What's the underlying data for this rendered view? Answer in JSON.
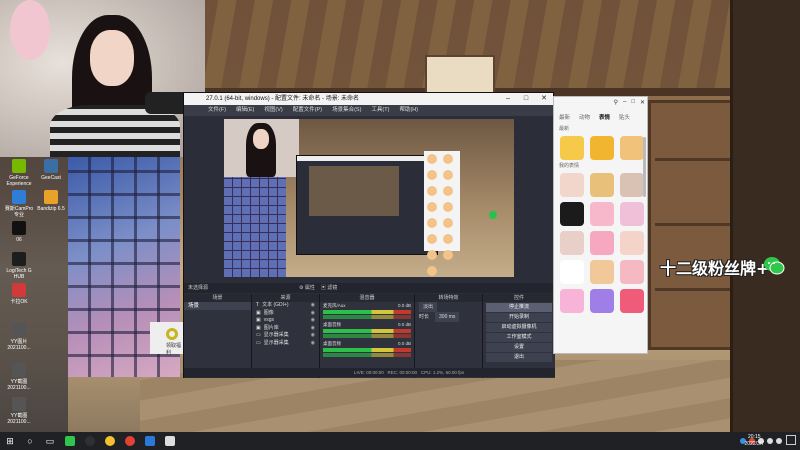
{
  "desktop": {
    "icons": [
      {
        "label": "GeForce Experience",
        "color": "#76b900"
      },
      {
        "label": "GeeCast",
        "color": "#3a6ea5"
      },
      {
        "label": "赛斯CamPro 专业",
        "color": "#2f7dd6"
      },
      {
        "label": "Bandizip 6.5",
        "color": "#e8a22a"
      },
      {
        "label": "06",
        "color": "#111111"
      },
      {
        "label": "LogiTech G HUB",
        "color": "#1d1d1d"
      },
      {
        "label": "卡拉OK",
        "color": "#d23a3a"
      },
      {
        "label": "YY图片 2021100...",
        "color": "#555555"
      },
      {
        "label": "YY截图 2021100...",
        "color": "#555555"
      },
      {
        "label": "YY截图 2021100...",
        "color": "#555555"
      }
    ]
  },
  "obs": {
    "title": "27.0.1 (64-bit, windows) - 配置文件: 未命名 - 场景: 未命名",
    "menu": [
      "文件(F)",
      "编辑(E)",
      "视图(V)",
      "配置文件(P)",
      "场景集合(S)",
      "工具(T)",
      "帮助(H)"
    ],
    "no_source_label": "未选择源",
    "properties_label": "属性",
    "filters_label": "滤镜",
    "docks": {
      "scenes": {
        "header": "场景",
        "items": [
          "场景"
        ]
      },
      "sources": {
        "header": "来源",
        "items": [
          "文本 (GDI+)",
          "图像",
          "vsgs",
          "图片库",
          "显示器采集",
          "显示器采集"
        ]
      },
      "mixer": {
        "header": "混音器",
        "channels": [
          {
            "name": "麦克风/Aux",
            "level": "0.0 dB"
          },
          {
            "name": "桌面音频",
            "level": "0.0 dB"
          },
          {
            "name": "桌面音频",
            "level": "0.0 dB"
          }
        ]
      },
      "transitions": {
        "header": "转场特效",
        "type": "淡出",
        "duration_label": "时长",
        "duration": "300 ms"
      },
      "controls": {
        "header": "控件",
        "buttons": [
          "停止推流",
          "开始录制",
          "启动虚拟摄像机",
          "工作室模式",
          "设置",
          "退出"
        ]
      }
    },
    "status": {
      "live": "LIVE: 00:00:00",
      "rec": "REC: 00:00:00",
      "cpu": "CPU: 1.2%, 60.00 fps"
    }
  },
  "emoji_panel": {
    "tabs": [
      "最新",
      "动物",
      "表情",
      "贴头"
    ],
    "active_tab": "表情",
    "section_top": "最新",
    "section_mid": "我的表情",
    "cells_row1": [
      "#f6c948",
      "#f1b52f",
      "#f0c27a"
    ],
    "cells_grid": [
      "#f2d6cc",
      "#e8c07a",
      "#d9c2b3",
      "#1b1b1b",
      "#f7b8cc",
      "#f0c0d8",
      "#e8d0c8",
      "#f6a8c0",
      "#f4d3c8",
      "#ffffff",
      "#f0c89a",
      "#f5b9c4",
      "#f7b3d8",
      "#9f7ee8",
      "#ef5b78"
    ]
  },
  "overlay": {
    "fan_text": "十二级粉丝牌+",
    "small_ad_label": "领取福利"
  },
  "taskbar": {
    "apps": [
      {
        "name": "windows-start",
        "color": "#ffffff"
      },
      {
        "name": "search",
        "color": "#ffffff"
      },
      {
        "name": "task-view",
        "color": "#ffffff"
      },
      {
        "name": "wechat",
        "color": "#2fc64c"
      },
      {
        "name": "obs",
        "color": "#303030"
      },
      {
        "name": "yy",
        "color": "#f6c12f"
      },
      {
        "name": "chrome",
        "color": "#e44134"
      },
      {
        "name": "app-blue",
        "color": "#2b78d8"
      },
      {
        "name": "app-white",
        "color": "#dddddd"
      }
    ],
    "time": "20:15",
    "date": "2022/3/7"
  }
}
